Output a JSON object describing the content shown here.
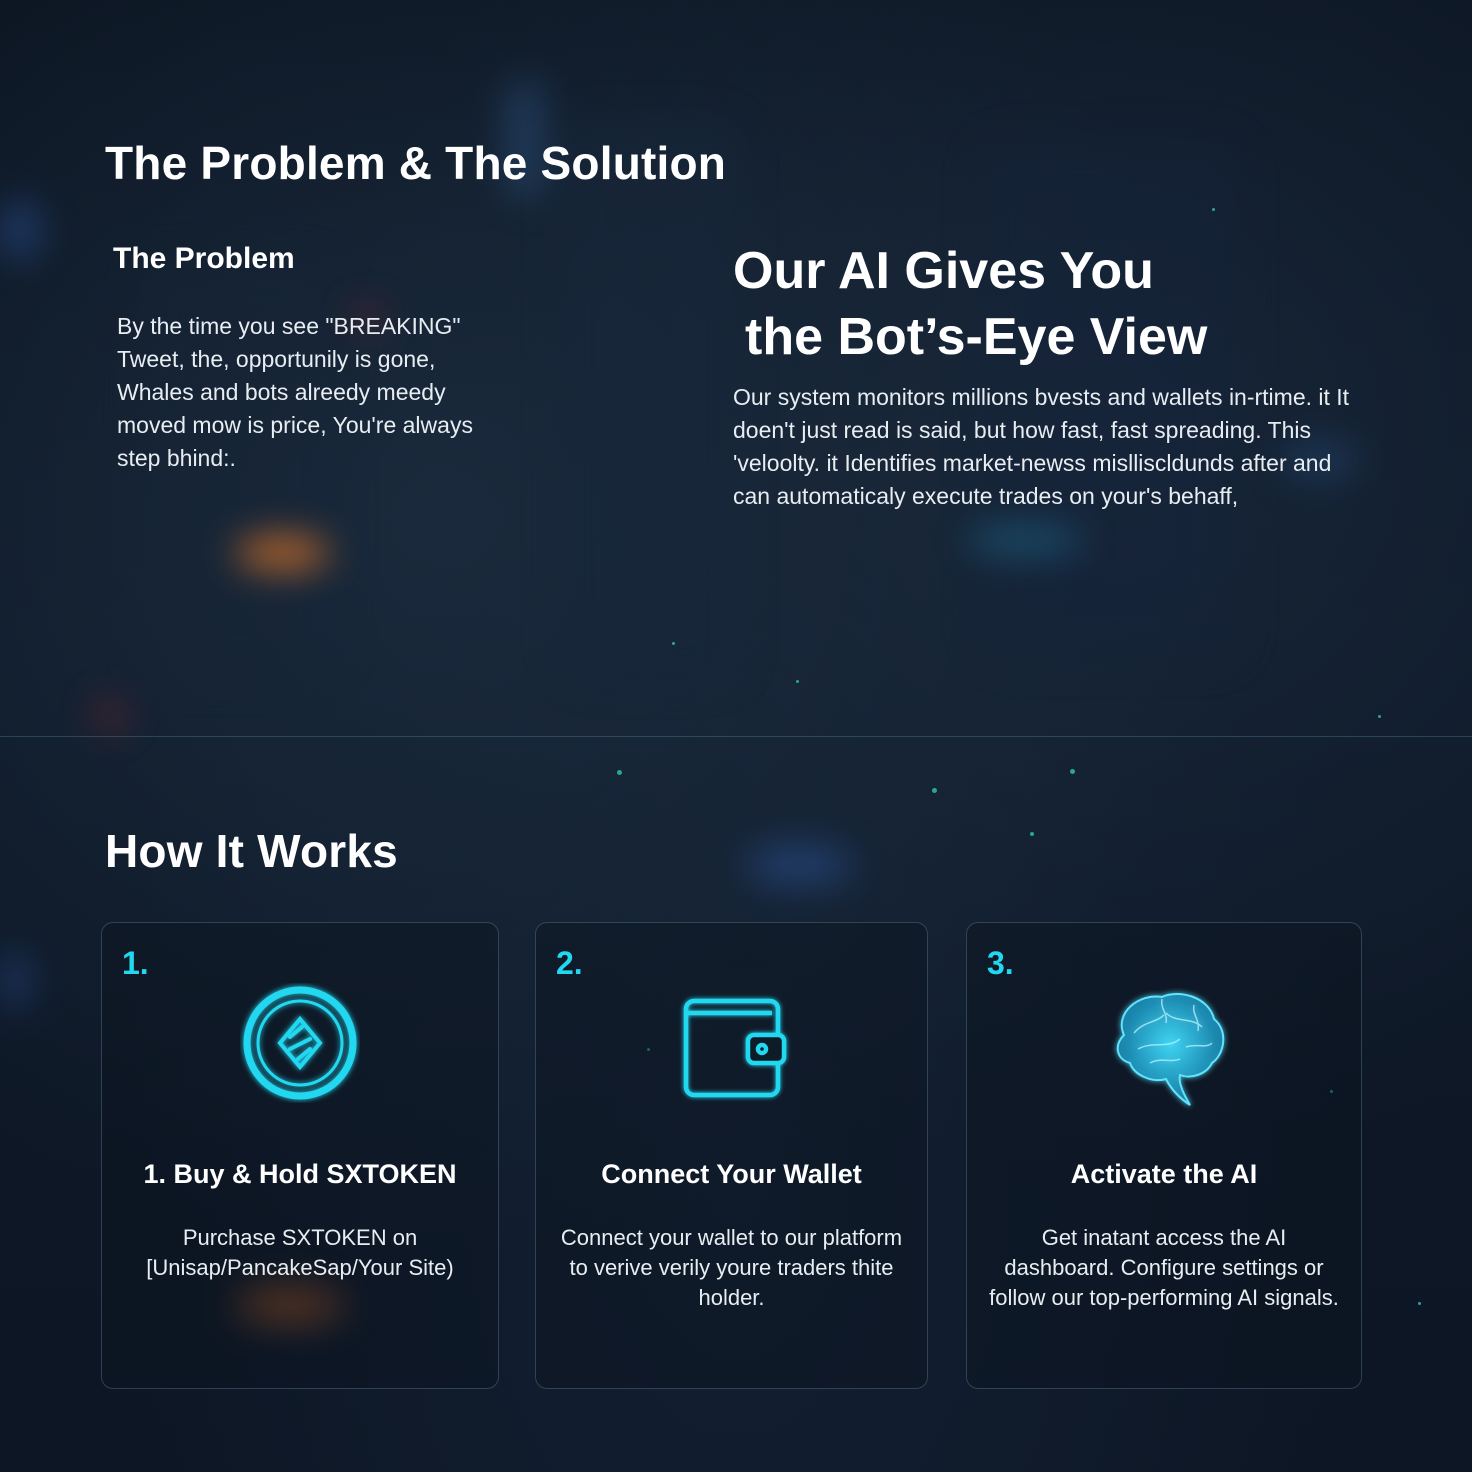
{
  "colors": {
    "accent": "#22d8f0",
    "background": "#0b1420",
    "text": "#ffffff"
  },
  "problem_solution": {
    "title": "The Problem & The Solution",
    "problem": {
      "heading": "The Problem",
      "body": "By the time you see \"BREAKING\" Tweet, the, opportunily is gone, Whales and bots alreedy meedy moved mow is price, You're always step bhind:."
    },
    "solution": {
      "heading_line1": "Our AI Gives You",
      "heading_line2": "the Bot’s-Eye View",
      "body": "Our system monitors millions bvests and wallets in-rtime. it It doen't just read is said, but how fast, fast spreading. This 'veloolty. it Identifies market-newss mislliscldunds after and can automaticaly execute trades on your's behaff,"
    }
  },
  "how_it_works": {
    "title": "How It Works",
    "steps": [
      {
        "number": "1.",
        "icon": "token-coin-icon",
        "title": "1. Buy & Hold SXTOKEN",
        "description": "Purchase SXTOKEN on [Unisap/PancakeSap/Your Site)"
      },
      {
        "number": "2.",
        "icon": "wallet-icon",
        "title": "Connect Your Wallet",
        "description": "Connect your wallet to our platform to verive verily youre traders thite holder."
      },
      {
        "number": "3.",
        "icon": "brain-icon",
        "title": "Activate the AI",
        "description": "Get inatant access the AI dashboard. Configure settings or follow our top-performing AI signals."
      }
    ]
  }
}
